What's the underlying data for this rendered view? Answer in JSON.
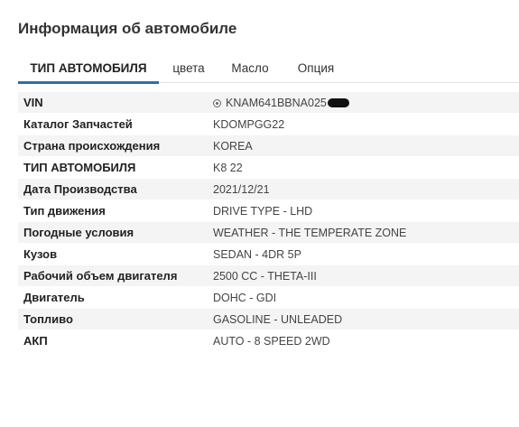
{
  "page": {
    "title": "Информация об автомобиле"
  },
  "tabs": [
    {
      "label": "ТИП АВТОМОБИЛЯ",
      "active": true
    },
    {
      "label": "цвета",
      "active": false
    },
    {
      "label": "Масло",
      "active": false
    },
    {
      "label": "Опция",
      "active": false
    }
  ],
  "details": {
    "vin": {
      "label": "VIN",
      "value": "KNAM641BBNA025"
    },
    "rows": [
      {
        "label": "Каталог Запчастей",
        "value": "KDOMPGG22"
      },
      {
        "label": "Страна происхождения",
        "value": "KOREA"
      },
      {
        "label": "ТИП АВТОМОБИЛЯ",
        "value": "K8 22"
      },
      {
        "label": "Дата Производства",
        "value": "2021/12/21"
      },
      {
        "label": "Тип движения",
        "value": "DRIVE TYPE - LHD"
      },
      {
        "label": "Погодные условия",
        "value": "WEATHER - THE TEMPERATE ZONE"
      },
      {
        "label": "Кузов",
        "value": "SEDAN - 4DR 5P"
      },
      {
        "label": "Рабочий объем двигателя",
        "value": "2500 CC - THETA-III"
      },
      {
        "label": "Двигатель",
        "value": "DOHC - GDI"
      },
      {
        "label": "Топливо",
        "value": "GASOLINE - UNLEADED"
      },
      {
        "label": "АКП",
        "value": "AUTO - 8 SPEED 2WD"
      }
    ]
  },
  "colors": {
    "accent": "#2a6fb0",
    "row_alt": "#f4f4f4",
    "redaction": "#111111"
  },
  "icons": {
    "vin": "circle-dot-icon"
  }
}
